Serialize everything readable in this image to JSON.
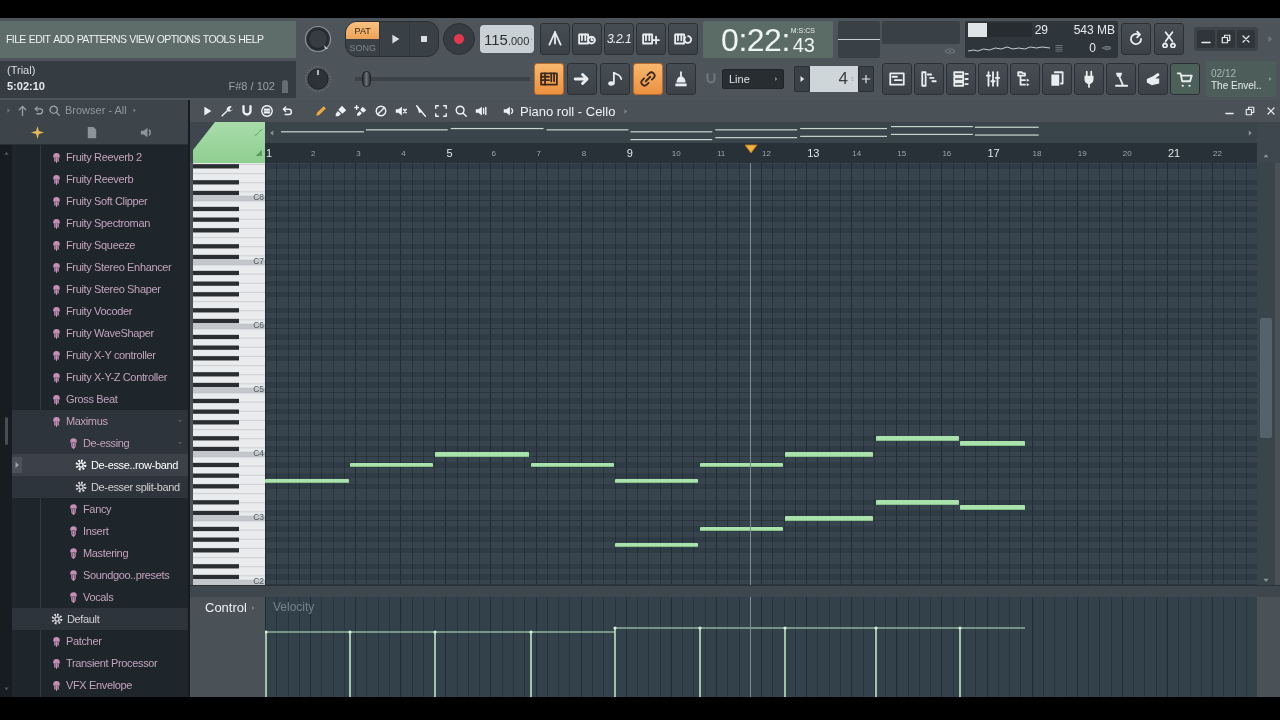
{
  "menu": {
    "items": [
      "FILE",
      "EDIT",
      "ADD",
      "PATTERNS",
      "VIEW",
      "OPTIONS",
      "TOOLS",
      "HELP"
    ]
  },
  "hint_panel": {
    "title": "(Trial)",
    "time": "5:02:10",
    "note": "F#8 / 102"
  },
  "transport": {
    "modes": [
      {
        "label": "PAT",
        "selected": true
      },
      {
        "label": "SONG",
        "selected": false
      }
    ],
    "tempo": {
      "whole": "115",
      "fraction": ".000"
    },
    "song_position": {
      "level": 0.04
    }
  },
  "record_buttons": {
    "countdown": "3.2.1"
  },
  "toggles": [
    {
      "on": true
    },
    {
      "on": false
    },
    {
      "on": false
    },
    {
      "on": true
    },
    {
      "on": false
    }
  ],
  "time_display": {
    "main": "0:22:",
    "small": "43",
    "unit": "M:S:CS"
  },
  "performance": {
    "cpu": {
      "level": 0.3,
      "value": "29"
    },
    "memory": "543 MB",
    "polyphony": "0"
  },
  "snap": {
    "value": "Line"
  },
  "stepper": {
    "value": "4"
  },
  "hint_bar": {
    "counter": "02/12",
    "text": "The Envel.."
  },
  "browser": {
    "title": "Browser - All",
    "items": [
      {
        "label": "Fruity Reeverb 2",
        "kind": "plugin",
        "selected": false,
        "highlighted": false,
        "expanded": false
      },
      {
        "label": "Fruity Reeverb",
        "kind": "plugin",
        "selected": false,
        "highlighted": false,
        "expanded": false
      },
      {
        "label": "Fruity Soft Clipper",
        "kind": "plugin",
        "selected": false,
        "highlighted": false,
        "expanded": false
      },
      {
        "label": "Fruity Spectroman",
        "kind": "plugin",
        "selected": false,
        "highlighted": false,
        "expanded": false
      },
      {
        "label": "Fruity Squeeze",
        "kind": "plugin",
        "selected": false,
        "highlighted": false,
        "expanded": false
      },
      {
        "label": "Fruity Stereo Enhancer",
        "kind": "plugin",
        "selected": false,
        "highlighted": false,
        "expanded": false
      },
      {
        "label": "Fruity Stereo Shaper",
        "kind": "plugin",
        "selected": false,
        "highlighted": false,
        "expanded": false
      },
      {
        "label": "Fruity Vocoder",
        "kind": "plugin",
        "selected": false,
        "highlighted": false,
        "expanded": false
      },
      {
        "label": "Fruity WaveShaper",
        "kind": "plugin",
        "selected": false,
        "highlighted": false,
        "expanded": false
      },
      {
        "label": "Fruity X-Y controller",
        "kind": "plugin",
        "selected": false,
        "highlighted": false,
        "expanded": false
      },
      {
        "label": "Fruity X-Y-Z Controller",
        "kind": "plugin",
        "selected": false,
        "highlighted": false,
        "expanded": false
      },
      {
        "label": "Gross Beat",
        "kind": "plugin",
        "selected": false,
        "highlighted": false,
        "expanded": false
      },
      {
        "label": "Maximus",
        "kind": "plugin",
        "selected": false,
        "highlighted": true,
        "expanded": true,
        "children": [
          {
            "label": "De-essing",
            "kind": "folder",
            "selected": false,
            "highlighted": true,
            "expanded": true,
            "children": [
              {
                "label": "De-esse..row-band",
                "kind": "preset",
                "selected": true,
                "highlighted": true,
                "expanded": false
              },
              {
                "label": "De-esser split-band",
                "kind": "preset",
                "selected": false,
                "highlighted": true,
                "expanded": false
              }
            ]
          },
          {
            "label": "Fancy",
            "kind": "folder",
            "selected": false,
            "highlighted": false,
            "expanded": false
          },
          {
            "label": "Insert",
            "kind": "folder",
            "selected": false,
            "highlighted": false,
            "expanded": false
          },
          {
            "label": "Mastering",
            "kind": "folder",
            "selected": false,
            "highlighted": false,
            "expanded": false
          },
          {
            "label": "Soundgoo..presets",
            "kind": "folder",
            "selected": false,
            "highlighted": false,
            "expanded": false
          },
          {
            "label": "Vocals",
            "kind": "folder",
            "selected": false,
            "highlighted": false,
            "expanded": false
          }
        ]
      },
      {
        "label": "Default",
        "kind": "preset",
        "selected": false,
        "highlighted": true,
        "expanded": false
      },
      {
        "label": "Patcher",
        "kind": "plugin",
        "selected": false,
        "highlighted": false,
        "expanded": false
      },
      {
        "label": "Transient Processor",
        "kind": "plugin",
        "selected": false,
        "highlighted": false,
        "expanded": false
      },
      {
        "label": "VFX Envelope",
        "kind": "plugin",
        "selected": false,
        "highlighted": false,
        "expanded": false
      }
    ]
  },
  "piano_roll": {
    "title": "Piano roll - Cello",
    "tools": [
      {
        "selected": true
      },
      {
        "selected": false
      },
      {
        "selected": false
      },
      {
        "selected": false
      },
      {
        "selected": false
      },
      {
        "selected": false
      },
      {
        "selected": false
      },
      {
        "selected": false
      },
      {
        "selected": false
      }
    ],
    "ruler": [
      "1",
      "2",
      "3",
      "4",
      "5",
      "6",
      "7",
      "8",
      "9",
      "10",
      "11",
      "12",
      "13",
      "14",
      "15",
      "16",
      "17",
      "18",
      "19",
      "20",
      "21",
      "22"
    ],
    "octave_labels": [
      "C8",
      "C7",
      "C6",
      "C5",
      "C4",
      "C3",
      "C2"
    ],
    "control": {
      "label": "Control",
      "parameter": "Velocity"
    }
  }
}
